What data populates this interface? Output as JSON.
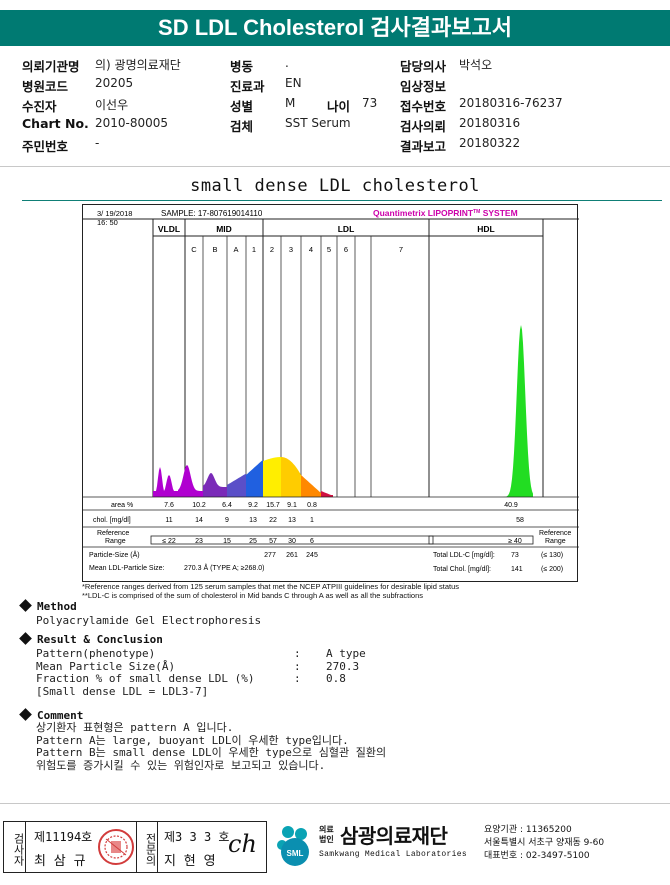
{
  "header": {
    "title": "SD LDL Cholesterol 검사결과보고서"
  },
  "info": {
    "col1": [
      {
        "label": "의뢰기관명",
        "value": "의) 광명의료재단"
      },
      {
        "label": "병원코드",
        "value": "20205"
      },
      {
        "label": "수진자",
        "value": "이선우"
      },
      {
        "label": "Chart No.",
        "value": "2010-80005"
      },
      {
        "label": "주민번호",
        "value": "-"
      }
    ],
    "col2": [
      {
        "label": "병동",
        "value": "."
      },
      {
        "label": "진료과",
        "value": "EN"
      },
      {
        "label": "성별",
        "value": "M"
      },
      {
        "label": "검체",
        "value": "SST Serum"
      }
    ],
    "age_label": "나이",
    "age_value": "73",
    "col3": [
      {
        "label": "담당의사",
        "value": "박석오"
      },
      {
        "label": "임상정보",
        "value": ""
      },
      {
        "label": "접수번호",
        "value": "20180316-76237"
      },
      {
        "label": "검사의뢰",
        "value": "20180316"
      },
      {
        "label": "결과보고",
        "value": "20180322"
      }
    ]
  },
  "section_title": "small dense LDL cholesterol",
  "chart": {
    "date": "3/ 19/2018",
    "time": "16: 50",
    "sample": "SAMPLE:  17-807619014110",
    "brand": "Quantimetrix LIPOPRINT",
    "brand_tm": "TM",
    "brand_suffix": " SYSTEM",
    "groups": {
      "vldl": "VLDL",
      "mid": "MID",
      "ldl": "LDL",
      "hdl": "HDL"
    },
    "band_labels": [
      "C",
      "B",
      "A",
      "1",
      "2",
      "3",
      "4",
      "5",
      "6",
      "7"
    ],
    "row_labels": {
      "area": "area %",
      "chol": "chol. [mg/dl]",
      "ref": "Reference\nRange",
      "ps": "Particle-Size (Å)",
      "mps": "Mean LDL-Particle Size:"
    },
    "area_values": [
      "7.6",
      "10.2",
      "6.4",
      "9.2",
      "15.7",
      "9.1",
      "0.8"
    ],
    "area_hdl": "40.9",
    "chol_values": [
      "11",
      "14",
      "9",
      "13",
      "22",
      "13",
      "1"
    ],
    "chol_hdl": "58",
    "ref_values": [
      "≤ 22",
      "23",
      "15",
      "25",
      "57",
      "30",
      "6"
    ],
    "ref_hdl": "≥ 40",
    "ref_right_label": "Reference\nRange",
    "particle_sizes": [
      "277",
      "261",
      "245"
    ],
    "mean_ps": "270.3 Å  (TYPE A; ≥268.0)",
    "total_ldl_label": "Total LDL-C [mg/dl]:",
    "total_ldl_value": "73",
    "total_ldl_ref": "(≤ 130)",
    "total_chol_label": "Total Chol. [mg/dl]:",
    "total_chol_value": "141",
    "total_chol_ref": "(≤ 200)",
    "colors": {
      "vldl": "#b000d0",
      "c": "#7a2ab8",
      "b": "#5a4fc8",
      "a": "#2060e0",
      "l1": "#ffee00",
      "l2": "#ffcc00",
      "l3": "#ff8800",
      "l4": "#d01040",
      "hdl": "#22dd22"
    }
  },
  "footnotes": [
    "*Reference ranges derived from 125 serum samples that met the NCEP ATPIII guidelines for desirable lipid status",
    "**LDL-C is comprised of the sum of cholesterol in Mid bands C through A as well as all the subfractions"
  ],
  "method": {
    "heading": "Method",
    "text": "Polyacrylamide Gel Electrophoresis"
  },
  "result": {
    "heading": "Result & Conclusion",
    "rows": [
      {
        "label": "Pattern(phenotype)",
        "value": "A type"
      },
      {
        "label": "Mean Particle Size(Å)",
        "value": "270.3"
      },
      {
        "label": "Fraction % of small dense LDL (%)",
        "value": "0.8"
      }
    ],
    "sub": "[Small dense LDL = LDL3-7]"
  },
  "comment": {
    "heading": "Comment",
    "lines": [
      "상기환자 표현형은 pattern A 입니다.",
      "Pattern A는 large, buoyant LDL이 우세한 type입니다.",
      "Pattern B는 small dense LDL이 우세한 type으로 심혈관 질환의",
      "위험도를 증가시킬 수 있는 위험인자로 보고되고 있습니다."
    ]
  },
  "footer": {
    "tester_label": "검사자",
    "tester_no": "제11194호",
    "tester_name": "최 삼 규",
    "doctor_label": "전문의",
    "doctor_no": "제3 3 3 호",
    "doctor_name": "지 현 영",
    "signature": "ch",
    "logo_sub1": "의료",
    "logo_sub2": "법인",
    "logo_name": "삼광의료재단",
    "logo_en": "Samkwang Medical Laboratories",
    "logo_badge": "SML",
    "org_code": "요양기관 : 11365200",
    "address": "서울특별시 서초구 양재동 9-60",
    "phone": "대표번호 : 02-3497-5100"
  }
}
